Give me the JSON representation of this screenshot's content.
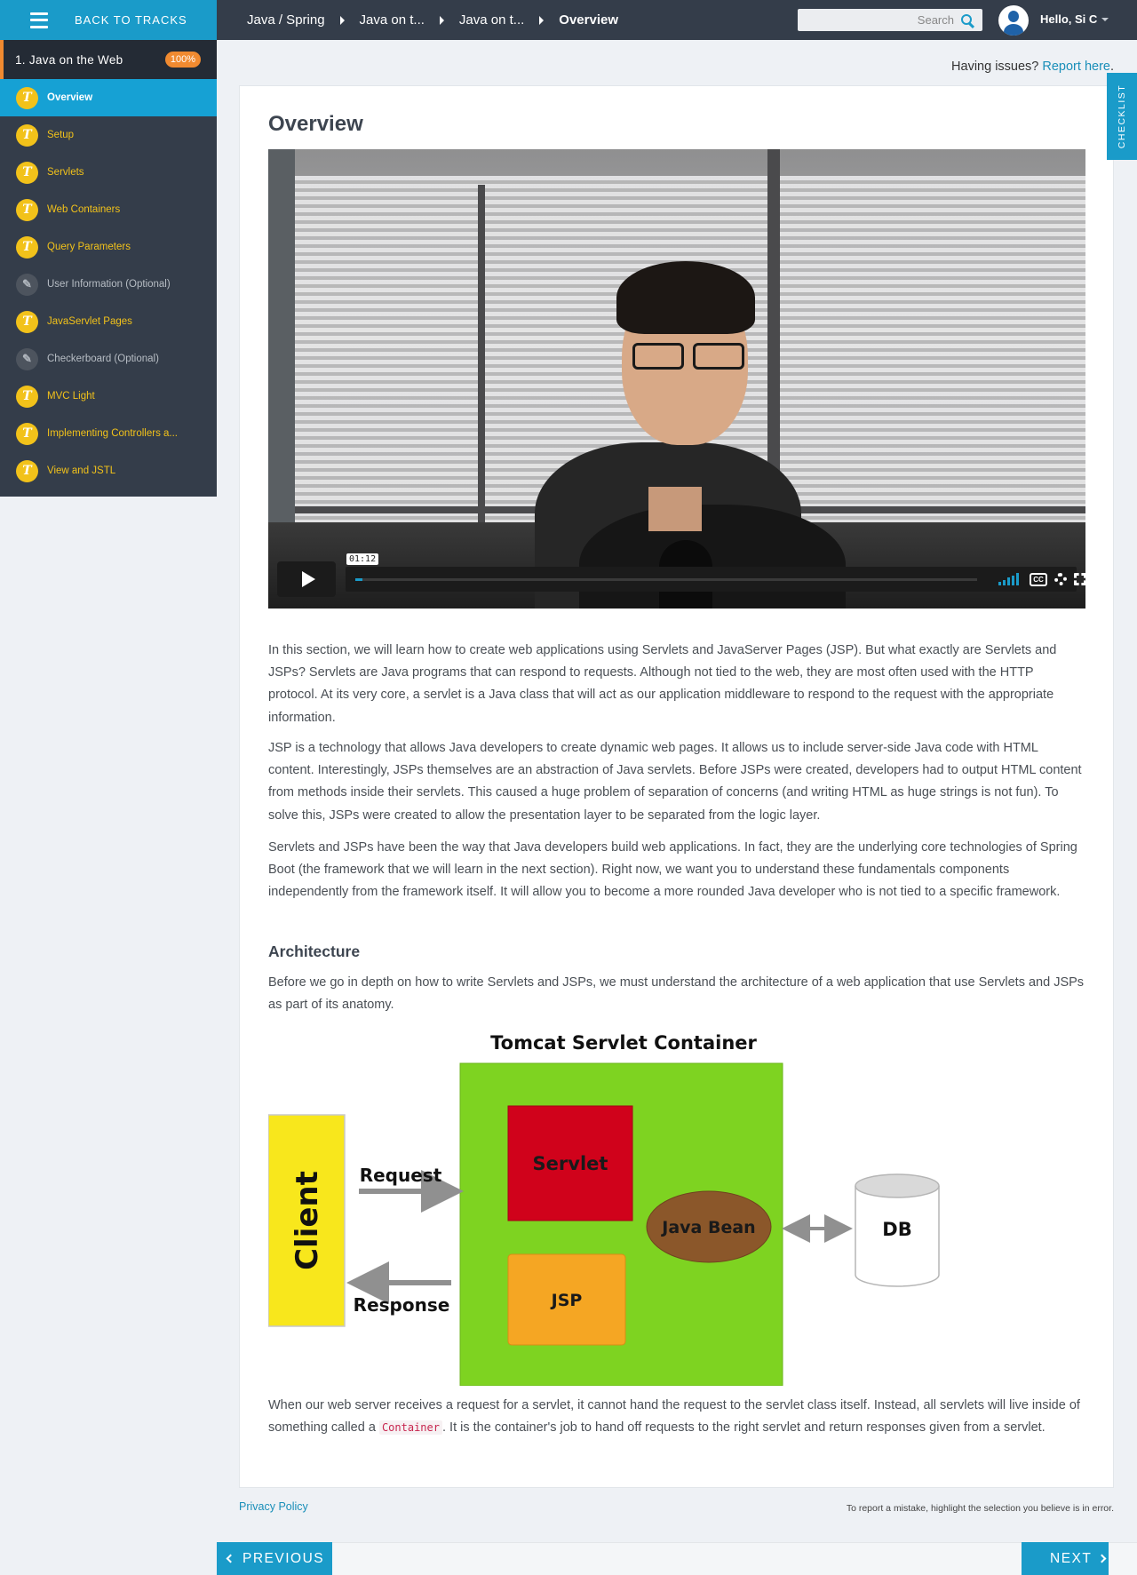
{
  "topbar": {
    "back_label": "BACK TO TRACKS",
    "breadcrumbs": [
      "Java / Spring",
      "Java on t...",
      "Java on t...",
      "Overview"
    ],
    "search_placeholder": "Search",
    "user_greeting": "Hello, Si C"
  },
  "sidebar": {
    "chapter_title": "1. Java on the Web",
    "chapter_progress": "100%",
    "lessons": [
      {
        "label": "Overview",
        "icon": "T",
        "state": "active"
      },
      {
        "label": "Setup",
        "icon": "T",
        "state": "normal"
      },
      {
        "label": "Servlets",
        "icon": "T",
        "state": "normal"
      },
      {
        "label": "Web Containers",
        "icon": "T",
        "state": "normal"
      },
      {
        "label": "Query Parameters",
        "icon": "T",
        "state": "normal"
      },
      {
        "label": "User Information (Optional)",
        "icon": "pencil-icon",
        "state": "optional"
      },
      {
        "label": "JavaServlet Pages",
        "icon": "T",
        "state": "normal"
      },
      {
        "label": "Checkerboard (Optional)",
        "icon": "pencil-icon",
        "state": "optional"
      },
      {
        "label": "MVC Light",
        "icon": "T",
        "state": "normal"
      },
      {
        "label": "Implementing Controllers a...",
        "icon": "T",
        "state": "normal"
      },
      {
        "label": "View and JSTL",
        "icon": "T",
        "state": "normal"
      }
    ]
  },
  "content": {
    "issues_text": "Having issues?",
    "issues_link": "Report here",
    "issues_period": ".",
    "checklist_label": "CHECKLIST",
    "title": "Overview",
    "video": {
      "timecode": "01:12",
      "progress": 0.012,
      "cc_label": "CC"
    },
    "paragraphs": [
      "In this section, we will learn how to create web applications using Servlets and JavaServer Pages (JSP). But what exactly are Servlets and JSPs? Servlets are Java programs that can respond to requests. Although not tied to the web, they are most often used with the HTTP protocol. At its very core, a servlet is a Java class that will act as our application middleware to respond to the request with the appropriate information.",
      "JSP is a technology that allows Java developers to create dynamic web pages. It allows us to include server-side Java code with HTML content. Interestingly, JSPs themselves are an abstraction of Java servlets. Before JSPs were created, developers had to output HTML content from methods inside their servlets. This caused a huge problem of separation of concerns (and writing HTML as huge strings is not fun). To solve this, JSPs were created to allow the presentation layer to be separated from the logic layer.",
      "Servlets and JSPs have been the way that Java developers build web applications. In fact, they are the underlying core technologies of Spring Boot (the framework that we will learn in the next section). Right now, we want you to understand these fundamentals components independently from the framework itself. It will allow you to become a more rounded Java developer who is not tied to a specific framework."
    ],
    "architecture_heading": "Architecture",
    "architecture_intro": "Before we go in depth on how to write Servlets and JSPs, we must understand the architecture of a web application that use Servlets and JSPs as part of its anatomy.",
    "diagram": {
      "title": "Tomcat Servlet Container",
      "client": "Client",
      "request": "Request",
      "response": "Response",
      "servlet": "Servlet",
      "jsp": "JSP",
      "java_bean": "Java Bean",
      "db": "DB"
    },
    "closing_before": "When our web server receives a request for a servlet, it cannot hand the request to the servlet class itself. Instead, all servlets will live inside of something called a",
    "closing_code": "Container",
    "closing_after": ". It is the container's job to hand off requests to the right servlet and return responses given from a servlet."
  },
  "footer": {
    "privacy": "Privacy Policy",
    "report_note": "To report a mistake, highlight the selection you believe is in error.",
    "previous": "PREVIOUS",
    "next": "NEXT"
  },
  "colors": {
    "accent": "#1a9bc9",
    "sidebar_bg": "#343d4a",
    "lesson_yellow": "#f2c21a",
    "badge_orange": "#f08a30",
    "container_green": "#7ed321",
    "servlet_red": "#d0021b",
    "jsp_orange": "#f5a623",
    "bean_brown": "#8b572a",
    "client_yellow": "#f8e71c"
  }
}
